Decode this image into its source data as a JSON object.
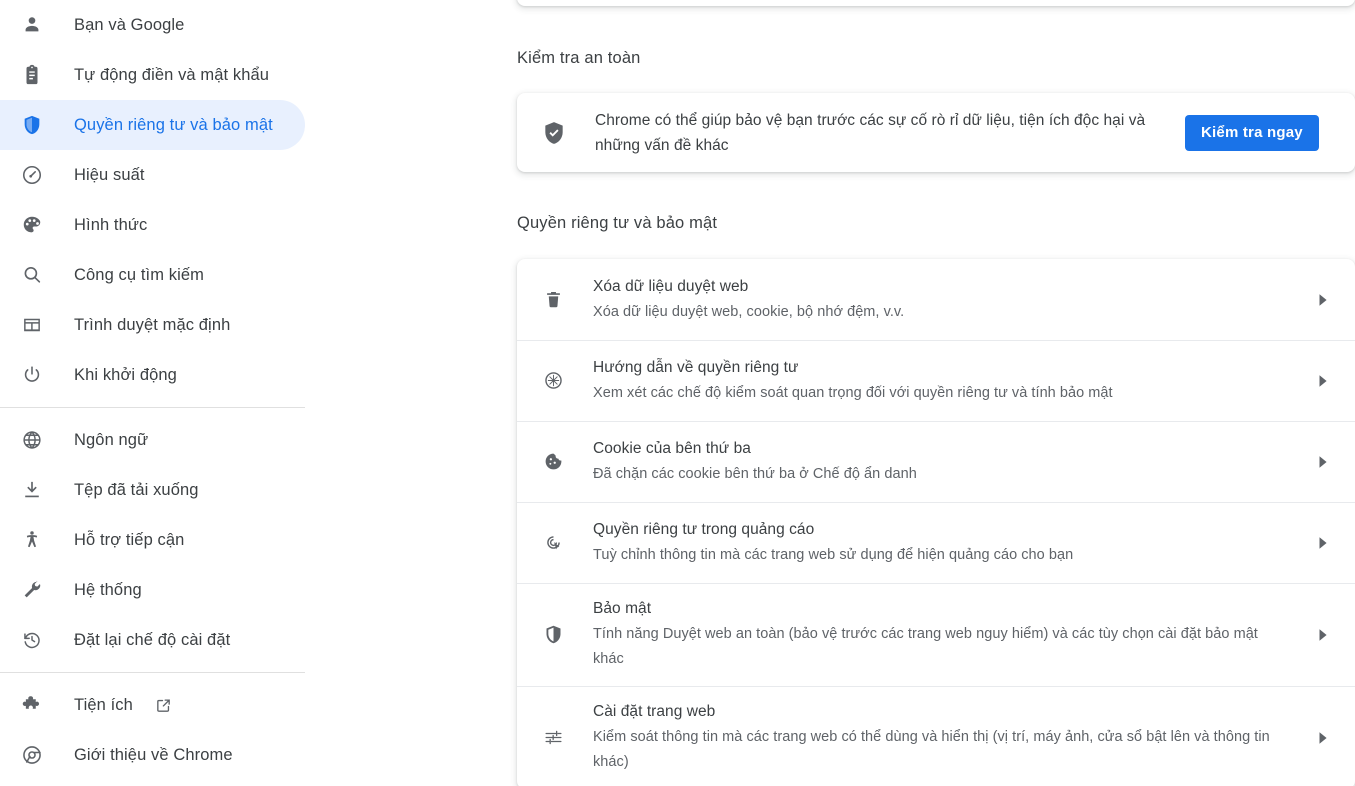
{
  "sidebar": {
    "groups": [
      {
        "items": [
          {
            "label": "Bạn và Google",
            "icon": "person-icon",
            "selected": false
          },
          {
            "label": "Tự động điền và mật khẩu",
            "icon": "clipboard-icon",
            "selected": false
          },
          {
            "label": "Quyền riêng tư và bảo mật",
            "icon": "shield-icon",
            "selected": true
          },
          {
            "label": "Hiệu suất",
            "icon": "speedometer-icon",
            "selected": false
          },
          {
            "label": "Hình thức",
            "icon": "palette-icon",
            "selected": false
          },
          {
            "label": "Công cụ tìm kiếm",
            "icon": "search-icon",
            "selected": false
          },
          {
            "label": "Trình duyệt mặc định",
            "icon": "browser-window-icon",
            "selected": false
          },
          {
            "label": "Khi khởi động",
            "icon": "power-icon",
            "selected": false
          }
        ]
      },
      {
        "items": [
          {
            "label": "Ngôn ngữ",
            "icon": "globe-icon",
            "selected": false
          },
          {
            "label": "Tệp đã tải xuống",
            "icon": "download-icon",
            "selected": false
          },
          {
            "label": "Hỗ trợ tiếp cận",
            "icon": "accessibility-icon",
            "selected": false
          },
          {
            "label": "Hệ thống",
            "icon": "wrench-icon",
            "selected": false
          },
          {
            "label": "Đặt lại chế độ cài đặt",
            "icon": "restore-icon",
            "selected": false
          }
        ]
      },
      {
        "items": [
          {
            "label": "Tiện ích",
            "icon": "puzzle-icon",
            "selected": false,
            "external": true,
            "external_icon": "external-link-icon"
          },
          {
            "label": "Giới thiệu về Chrome",
            "icon": "chrome-icon",
            "selected": false
          }
        ]
      }
    ]
  },
  "main": {
    "safety_check": {
      "title": "Kiểm tra an toàn",
      "icon": "shield-check-icon",
      "description": "Chrome có thể giúp bảo vệ bạn trước các sự cố rò rỉ dữ liệu, tiện ích độc hại và những vấn đề khác",
      "button_label": "Kiểm tra ngay"
    },
    "privacy_section": {
      "title": "Quyền riêng tư và bảo mật",
      "rows": [
        {
          "icon": "trash-icon",
          "title": "Xóa dữ liệu duyệt web",
          "subtitle": "Xóa dữ liệu duyệt web, cookie, bộ nhớ đệm, v.v.",
          "chevron": "chevron-right-icon"
        },
        {
          "icon": "compass-icon",
          "title": "Hướng dẫn về quyền riêng tư",
          "subtitle": "Xem xét các chế độ kiểm soát quan trọng đối với quyền riêng tư và tính bảo mật",
          "chevron": "chevron-right-icon"
        },
        {
          "icon": "cookie-icon",
          "title": "Cookie của bên thứ ba",
          "subtitle": "Đã chặn các cookie bên thứ ba ở Chế độ ẩn danh",
          "chevron": "chevron-right-icon"
        },
        {
          "icon": "ad-privacy-icon",
          "title": "Quyền riêng tư trong quảng cáo",
          "subtitle": "Tuỳ chỉnh thông tin mà các trang web sử dụng để hiện quảng cáo cho bạn",
          "chevron": "chevron-right-icon"
        },
        {
          "icon": "security-shield-icon",
          "title": "Bảo mật",
          "subtitle": "Tính năng Duyệt web an toàn (bảo vệ trước các trang web nguy hiểm) và các tùy chọn cài đặt bảo mật khác",
          "chevron": "chevron-right-icon"
        },
        {
          "icon": "tune-icon",
          "title": "Cài đặt trang web",
          "subtitle": "Kiểm soát thông tin mà các trang web có thể dùng và hiển thị (vị trí, máy ảnh, cửa sổ bật lên và thông tin khác)",
          "chevron": "chevron-right-icon"
        }
      ]
    }
  },
  "colors": {
    "accent": "#1a73e8",
    "selected_bg": "#e8f0fe",
    "text_primary": "#3c4043",
    "text_secondary": "#5f6368",
    "divider": "#e8eaed"
  }
}
